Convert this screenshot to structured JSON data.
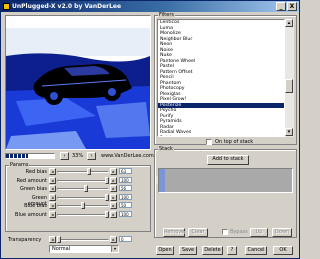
{
  "window": {
    "title": "UnPlugged-X v2.0 by VanDerLee",
    "minimize": "_",
    "close": "X"
  },
  "preview": {
    "zoom": "33%",
    "credit": "www.VanDerLee.com",
    "progress": 0.45
  },
  "params": {
    "group_label": "Params",
    "sliders": [
      {
        "label": "Red bias",
        "value": "63",
        "level": 0.62
      },
      {
        "label": "Red amount",
        "value": "100",
        "level": 1.0
      },
      {
        "label": "Green bias",
        "value": "56",
        "level": 0.56
      },
      {
        "label": "Green amount",
        "value": "100",
        "level": 1.0
      },
      {
        "label": "Blue bias",
        "value": "50",
        "level": 0.5
      },
      {
        "label": "Blue amount",
        "value": "100",
        "level": 1.0
      }
    ],
    "transparency_label": "Transparency",
    "transparency_value": "0",
    "blend_mode": "Normal"
  },
  "filters": {
    "group_label": "Filters",
    "items": [
      "Lenticos",
      "Luma",
      "Monolize",
      "Neighbor Blur",
      "Neon",
      "Noise",
      "Nuke",
      "Pantone Wheel",
      "Pastel",
      "Pattern Offset",
      "Pencil",
      "Phantom",
      "Photocopy",
      "Plexiglas",
      "Pixel Grow!",
      "Posterize",
      "Psycho",
      "Purify",
      "Pyramids",
      "Radar",
      "Radial Waves",
      "Rainbow"
    ],
    "selected_index": 15,
    "on_top_label": "On top of stack"
  },
  "stack": {
    "group_label": "Stack",
    "add_label": "Add to stack",
    "side_label": "stack",
    "remove": "Remove",
    "clear": "Clear",
    "bypass": "Bypass",
    "up": "Up",
    "down": "Down"
  },
  "footer": {
    "open": "Open",
    "save": "Save",
    "delete": "Delete",
    "help": "?",
    "cancel": "Cancel",
    "ok": "OK"
  }
}
